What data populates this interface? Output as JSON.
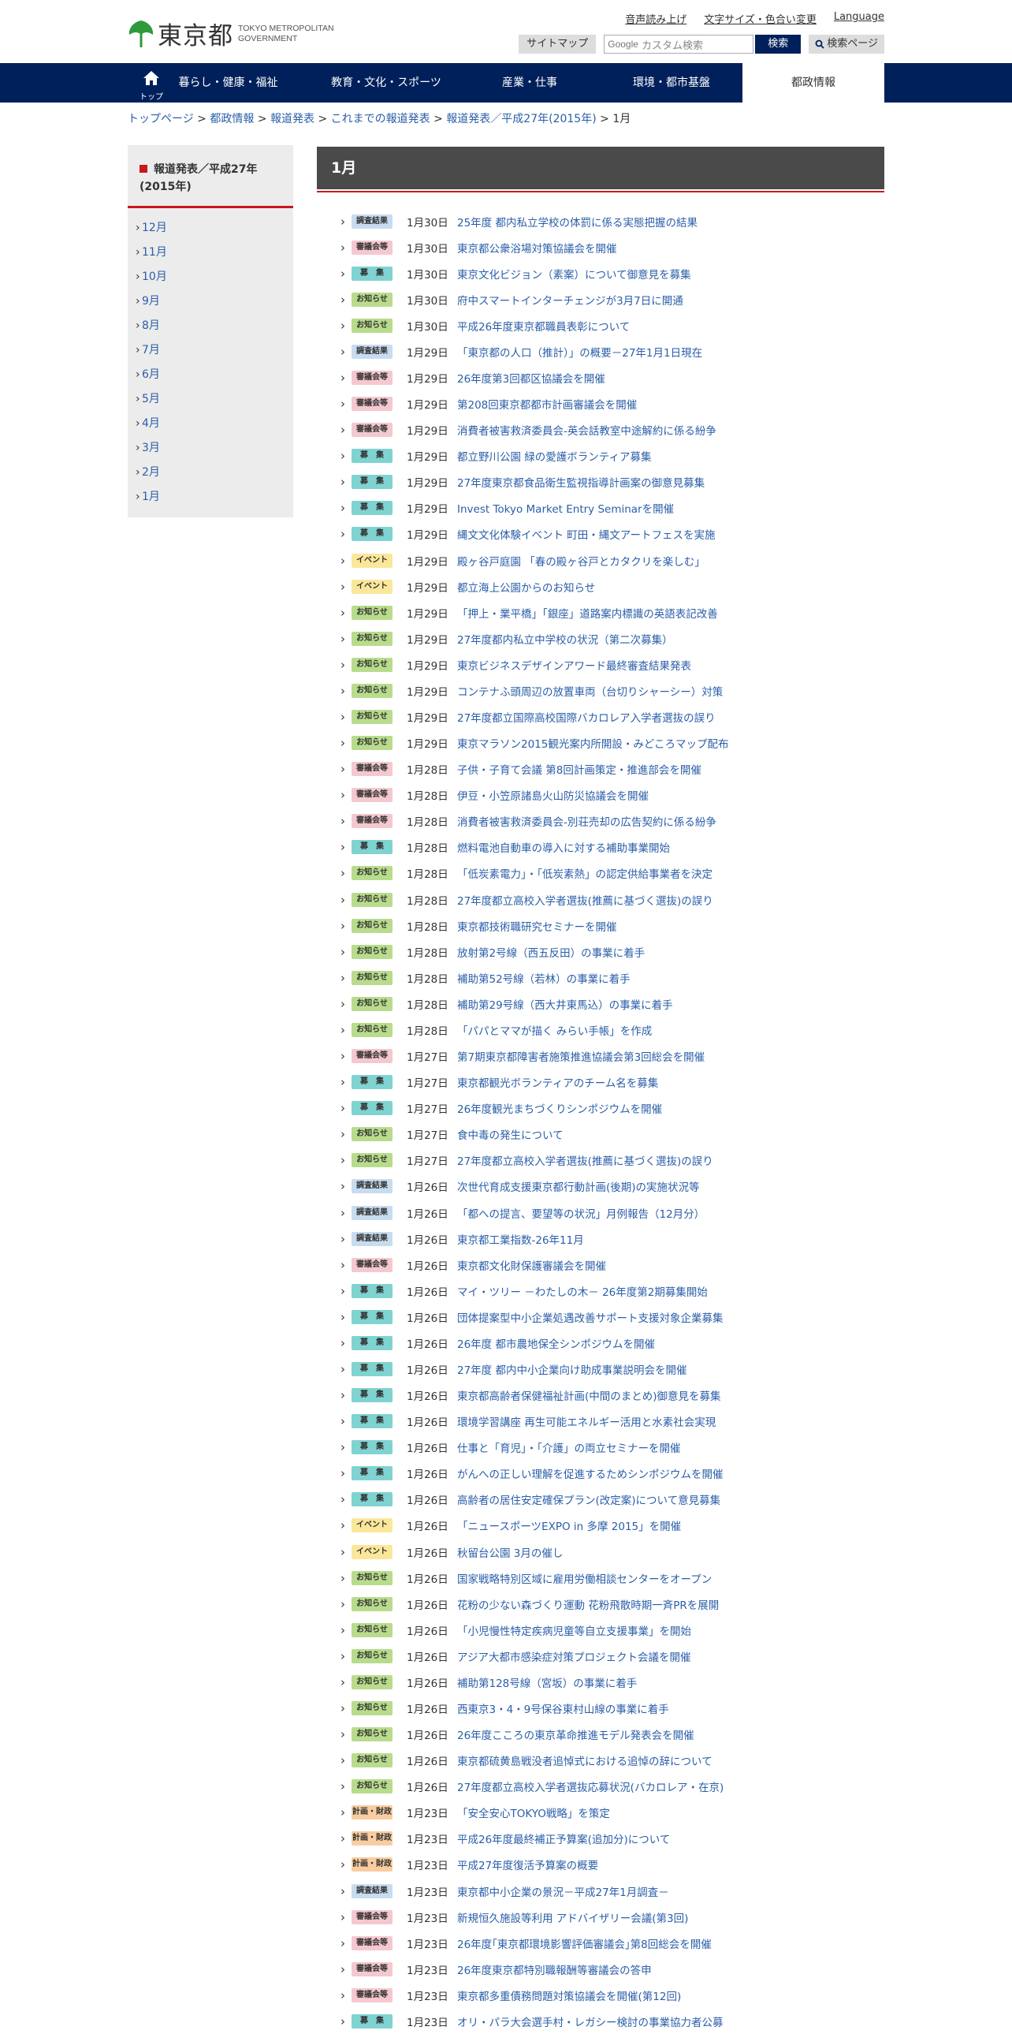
{
  "header": {
    "logo_jp": "東京都",
    "logo_en_1": "TOKYO METROPOLITAN",
    "logo_en_2": "GOVERNMENT",
    "links": [
      "音声読み上げ",
      "文字サイズ・色合い変更",
      "Language"
    ],
    "sitemap": "サイトマップ",
    "search_brand": "Google",
    "search_placeholder": "カスタム検索",
    "search_button": "検索",
    "search_page": "検索ページ"
  },
  "nav": {
    "home_label": "トップ",
    "items": [
      "暮らし・健康・福祉",
      "教育・文化・スポーツ",
      "産業・仕事",
      "環境・都市基盤",
      "都政情報"
    ]
  },
  "breadcrumb": [
    "トップページ",
    "都政情報",
    "報道発表",
    "これまでの報道発表",
    "報道発表／平成27年(2015年)",
    "1月"
  ],
  "sidebar": {
    "title": "報道発表／平成27年(2015年)",
    "months": [
      "12月",
      "11月",
      "10月",
      "9月",
      "8月",
      "7月",
      "6月",
      "5月",
      "4月",
      "3月",
      "2月",
      "1月"
    ]
  },
  "main": {
    "title": "1月"
  },
  "categories": {
    "research": {
      "label": "調査結果",
      "color": "#c8dcf0"
    },
    "council": {
      "label": "審議会等",
      "color": "#f5c8cf"
    },
    "recruit": {
      "label": "募　集",
      "color": "#7fd3d0"
    },
    "notice": {
      "label": "お知らせ",
      "color": "#b8dc8c"
    },
    "event": {
      "label": "イベント",
      "color": "#fbe79a"
    },
    "plan": {
      "label": "計画・財政",
      "color": "#f9cda0"
    }
  },
  "items": [
    {
      "c": "research",
      "d": "1月30日",
      "t": "25年度 都内私立学校の体罰に係る実態把握の結果"
    },
    {
      "c": "council",
      "d": "1月30日",
      "t": "東京都公衆浴場対策協議会を開催"
    },
    {
      "c": "recruit",
      "d": "1月30日",
      "t": "東京文化ビジョン（素案）について御意見を募集"
    },
    {
      "c": "notice",
      "d": "1月30日",
      "t": "府中スマートインターチェンジが3月7日に開通"
    },
    {
      "c": "notice",
      "d": "1月30日",
      "t": "平成26年度東京都職員表彰について"
    },
    {
      "c": "research",
      "d": "1月29日",
      "t": "「東京都の人口（推計）」の概要－27年1月1日現在"
    },
    {
      "c": "council",
      "d": "1月29日",
      "t": "26年度第3回都区協議会を開催"
    },
    {
      "c": "council",
      "d": "1月29日",
      "t": "第208回東京都都市計画審議会を開催"
    },
    {
      "c": "council",
      "d": "1月29日",
      "t": "消費者被害救済委員会-英会話教室中途解約に係る紛争"
    },
    {
      "c": "recruit",
      "d": "1月29日",
      "t": "都立野川公園 緑の愛護ボランティア募集"
    },
    {
      "c": "recruit",
      "d": "1月29日",
      "t": "27年度東京都食品衛生監視指導計画案の御意見募集"
    },
    {
      "c": "recruit",
      "d": "1月29日",
      "t": "Invest Tokyo Market Entry Seminarを開催"
    },
    {
      "c": "recruit",
      "d": "1月29日",
      "t": "縄文文化体験イベント 町田・縄文アートフェスを実施"
    },
    {
      "c": "event",
      "d": "1月29日",
      "t": "殿ヶ谷戸庭園 「春の殿ヶ谷戸とカタクリを楽しむ」"
    },
    {
      "c": "event",
      "d": "1月29日",
      "t": "都立海上公園からのお知らせ"
    },
    {
      "c": "notice",
      "d": "1月29日",
      "t": "「押上・業平橋」「銀座」道路案内標識の英語表記改善"
    },
    {
      "c": "notice",
      "d": "1月29日",
      "t": "27年度都内私立中学校の状況（第二次募集）"
    },
    {
      "c": "notice",
      "d": "1月29日",
      "t": "東京ビジネスデザインアワード最終審査結果発表"
    },
    {
      "c": "notice",
      "d": "1月29日",
      "t": "コンテナふ頭周辺の放置車両（台切りシャーシー）対策"
    },
    {
      "c": "notice",
      "d": "1月29日",
      "t": "27年度都立国際高校国際バカロレア入学者選抜の誤り"
    },
    {
      "c": "notice",
      "d": "1月29日",
      "t": "東京マラソン2015観光案内所開設・みどころマップ配布"
    },
    {
      "c": "council",
      "d": "1月28日",
      "t": "子供・子育て会議 第8回計画策定・推進部会を開催"
    },
    {
      "c": "council",
      "d": "1月28日",
      "t": "伊豆・小笠原諸島火山防災協議会を開催"
    },
    {
      "c": "council",
      "d": "1月28日",
      "t": "消費者被害救済委員会-別荘売却の広告契約に係る紛争"
    },
    {
      "c": "recruit",
      "d": "1月28日",
      "t": "燃料電池自動車の導入に対する補助事業開始"
    },
    {
      "c": "notice",
      "d": "1月28日",
      "t": "「低炭素電力」・「低炭素熱」の認定供給事業者を決定"
    },
    {
      "c": "notice",
      "d": "1月28日",
      "t": "27年度都立高校入学者選抜(推薦に基づく選抜)の誤り"
    },
    {
      "c": "notice",
      "d": "1月28日",
      "t": "東京都技術職研究セミナーを開催"
    },
    {
      "c": "notice",
      "d": "1月28日",
      "t": "放射第2号線（西五反田）の事業に着手"
    },
    {
      "c": "notice",
      "d": "1月28日",
      "t": "補助第52号線（若林）の事業に着手"
    },
    {
      "c": "notice",
      "d": "1月28日",
      "t": "補助第29号線（西大井東馬込）の事業に着手"
    },
    {
      "c": "notice",
      "d": "1月28日",
      "t": "「パパとママが描く みらい手帳」を作成"
    },
    {
      "c": "council",
      "d": "1月27日",
      "t": "第7期東京都障害者施策推進協議会第3回総会を開催"
    },
    {
      "c": "recruit",
      "d": "1月27日",
      "t": "東京都観光ボランティアのチーム名を募集"
    },
    {
      "c": "recruit",
      "d": "1月27日",
      "t": "26年度観光まちづくりシンポジウムを開催"
    },
    {
      "c": "notice",
      "d": "1月27日",
      "t": "食中毒の発生について"
    },
    {
      "c": "notice",
      "d": "1月27日",
      "t": "27年度都立高校入学者選抜(推薦に基づく選抜)の誤り"
    },
    {
      "c": "research",
      "d": "1月26日",
      "t": "次世代育成支援東京都行動計画(後期)の実施状況等"
    },
    {
      "c": "research",
      "d": "1月26日",
      "t": "「都への提言、要望等の状況」月例報告（12月分）"
    },
    {
      "c": "research",
      "d": "1月26日",
      "t": "東京都工業指数-26年11月"
    },
    {
      "c": "council",
      "d": "1月26日",
      "t": "東京都文化財保護審議会を開催"
    },
    {
      "c": "recruit",
      "d": "1月26日",
      "t": "マイ・ツリー －わたしの木－ 26年度第2期募集開始"
    },
    {
      "c": "recruit",
      "d": "1月26日",
      "t": "団体提案型中小企業処遇改善サポート支援対象企業募集"
    },
    {
      "c": "recruit",
      "d": "1月26日",
      "t": "26年度 都市農地保全シンポジウムを開催"
    },
    {
      "c": "recruit",
      "d": "1月26日",
      "t": "27年度 都内中小企業向け助成事業説明会を開催"
    },
    {
      "c": "recruit",
      "d": "1月26日",
      "t": "東京都高齢者保健福祉計画(中間のまとめ)御意見を募集"
    },
    {
      "c": "recruit",
      "d": "1月26日",
      "t": "環境学習講座 再生可能エネルギー活用と水素社会実現"
    },
    {
      "c": "recruit",
      "d": "1月26日",
      "t": "仕事と「育児」・「介護」の両立セミナーを開催"
    },
    {
      "c": "recruit",
      "d": "1月26日",
      "t": "がんへの正しい理解を促進するためシンポジウムを開催"
    },
    {
      "c": "recruit",
      "d": "1月26日",
      "t": "高齢者の居住安定確保プラン(改定案)について意見募集"
    },
    {
      "c": "event",
      "d": "1月26日",
      "t": "「ニュースポーツEXPO in 多摩 2015」を開催"
    },
    {
      "c": "event",
      "d": "1月26日",
      "t": "秋留台公園 3月の催し"
    },
    {
      "c": "notice",
      "d": "1月26日",
      "t": "国家戦略特別区域に雇用労働相談センターをオープン"
    },
    {
      "c": "notice",
      "d": "1月26日",
      "t": "花粉の少ない森づくり運動 花粉飛散時期一斉PRを展開"
    },
    {
      "c": "notice",
      "d": "1月26日",
      "t": "「小児慢性特定疾病児童等自立支援事業」を開始"
    },
    {
      "c": "notice",
      "d": "1月26日",
      "t": "アジア大都市感染症対策プロジェクト会議を開催"
    },
    {
      "c": "notice",
      "d": "1月26日",
      "t": "補助第128号線（宮坂）の事業に着手"
    },
    {
      "c": "notice",
      "d": "1月26日",
      "t": "西東京3・4・9号保谷東村山線の事業に着手"
    },
    {
      "c": "notice",
      "d": "1月26日",
      "t": "26年度こころの東京革命推進モデル発表会を開催"
    },
    {
      "c": "notice",
      "d": "1月26日",
      "t": "東京都硫黄島戦没者追悼式における追悼の辞について"
    },
    {
      "c": "notice",
      "d": "1月26日",
      "t": "27年度都立高校入学者選抜応募状況(バカロレア・在京)"
    },
    {
      "c": "plan",
      "d": "1月23日",
      "t": "「安全安心TOKYO戦略」を策定"
    },
    {
      "c": "plan",
      "d": "1月23日",
      "t": "平成26年度最終補正予算案(追加分)について"
    },
    {
      "c": "plan",
      "d": "1月23日",
      "t": "平成27年度復活予算案の概要"
    },
    {
      "c": "research",
      "d": "1月23日",
      "t": "東京都中小企業の景況－平成27年1月調査－"
    },
    {
      "c": "council",
      "d": "1月23日",
      "t": "新規恒久施設等利用 アドバイザリー会議(第3回)"
    },
    {
      "c": "council",
      "d": "1月23日",
      "t": "26年度｢東京都環境影響評価審議会｣第8回総会を開催"
    },
    {
      "c": "council",
      "d": "1月23日",
      "t": "26年度東京都特別職報酬等審議会の答申"
    },
    {
      "c": "council",
      "d": "1月23日",
      "t": "東京都多重債務問題対策協議会を開催(第12回)"
    },
    {
      "c": "recruit",
      "d": "1月23日",
      "t": "オリ・パラ大会選手村・レガシー検討の事業協力者公募"
    }
  ]
}
